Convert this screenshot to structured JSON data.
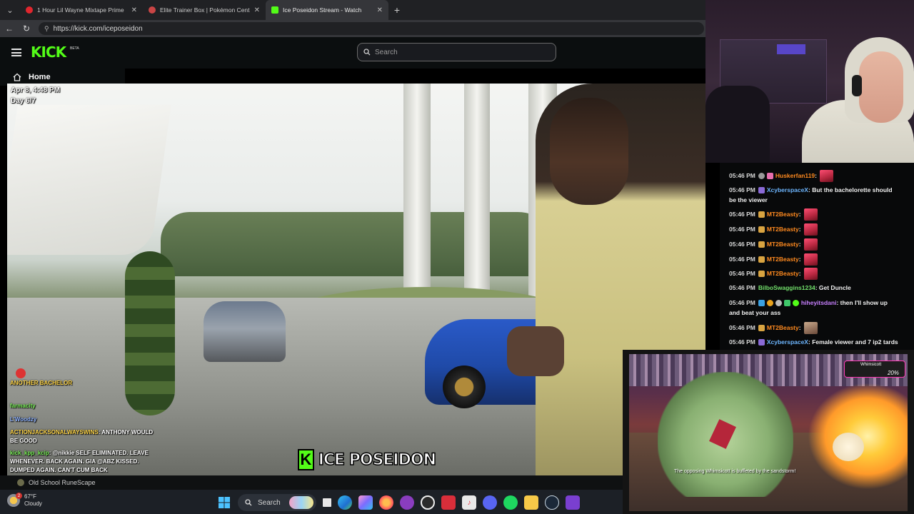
{
  "browser": {
    "tabs": [
      {
        "title": "1 Hour Lil Wayne Mixtape Prime",
        "favicon_color": "#e0262e",
        "active": false
      },
      {
        "title": "Elite Trainer Box | Pokémon Cent",
        "favicon_color": "#c94545",
        "active": false
      },
      {
        "title": "Ice Poseidon Stream - Watch",
        "favicon_color": "#53fc18",
        "active": true
      }
    ],
    "new_tab_symbol": "+",
    "url": "https://kick.com/iceposeidon"
  },
  "kick": {
    "logo": "KICK",
    "beta": "BETA",
    "search_placeholder": "Search",
    "home_label": "Home",
    "accent": "#53fc18"
  },
  "video": {
    "timestamp": "Apr 8, 4:48 PM",
    "day": "Day 6/7",
    "banner_k": "K",
    "banner_text": "ICE POSEIDON",
    "overlay_chat": [
      {
        "name": "ANOTHER BACHELOR",
        "text": ""
      },
      {
        "name": "farmacity",
        "text": ""
      },
      {
        "name": "L'Woodzy",
        "text": ""
      },
      {
        "name": "ACTIONJACKSONALWAYSWINS",
        "text": ": ANTHONY WOULD"
      },
      {
        "name": "",
        "text": "BE GOOD"
      },
      {
        "name": "kick_kpp_kcip",
        "text": ": @nikkie SELF ELIMINATED. LEAVE"
      },
      {
        "name": "",
        "text": "WHENEVER. BACK AGAIN. GIA @ABZ KISSED."
      },
      {
        "name": "",
        "text": "DUMPED AGAIN. CAN'T CUM BACK"
      }
    ]
  },
  "bottom_label": "Old School RuneScape",
  "taskbar": {
    "weather_temp": "67°F",
    "weather_desc": "Cloudy",
    "weather_badge": "2",
    "search_label": "Search"
  },
  "chat": {
    "messages": [
      {
        "time": "05:46 PM",
        "user": "Huskerfan119",
        "user_color": "orange",
        "text": "",
        "emote": true
      },
      {
        "time": "05:46 PM",
        "user": "XcyberspaceX",
        "user_color": "blue",
        "text": "But the bachelorette should",
        "emote": false
      },
      {
        "time": "",
        "user": "",
        "user_color": "",
        "text": "be the viewer",
        "emote": false
      },
      {
        "time": "05:46 PM",
        "user": "MT2Beasty",
        "user_color": "orange",
        "text": "",
        "emote": true
      },
      {
        "time": "05:46 PM",
        "user": "MT2Beasty",
        "user_color": "orange",
        "text": "",
        "emote": true
      },
      {
        "time": "05:46 PM",
        "user": "MT2Beasty",
        "user_color": "orange",
        "text": "",
        "emote": true
      },
      {
        "time": "05:46 PM",
        "user": "MT2Beasty",
        "user_color": "orange",
        "text": "",
        "emote": true
      },
      {
        "time": "05:46 PM",
        "user": "MT2Beasty",
        "user_color": "orange",
        "text": "",
        "emote": true
      },
      {
        "time": "05:46 PM",
        "user": "BilboSwaggins1234",
        "user_color": "green",
        "text": "Get Duncle",
        "emote": false
      },
      {
        "time": "05:46 PM",
        "user": "hiheyitsdani",
        "user_color": "purple",
        "text": "then I'll show up",
        "emote": false
      },
      {
        "time": "",
        "user": "",
        "user_color": "",
        "text": "and beat your ass",
        "emote": false
      },
      {
        "time": "05:46 PM",
        "user": "MT2Beasty",
        "user_color": "orange",
        "text": "",
        "emote": true
      },
      {
        "time": "05:46 PM",
        "user": "XcyberspaceX",
        "user_color": "blue",
        "text": "Female viewer and 7 ip2 tards",
        "emote": false
      }
    ]
  },
  "game": {
    "pokemon_name": "Whimsicott",
    "hp_percent": "20%",
    "message": "The opposing Whimsicott is buffeted by the sandstorm!"
  }
}
